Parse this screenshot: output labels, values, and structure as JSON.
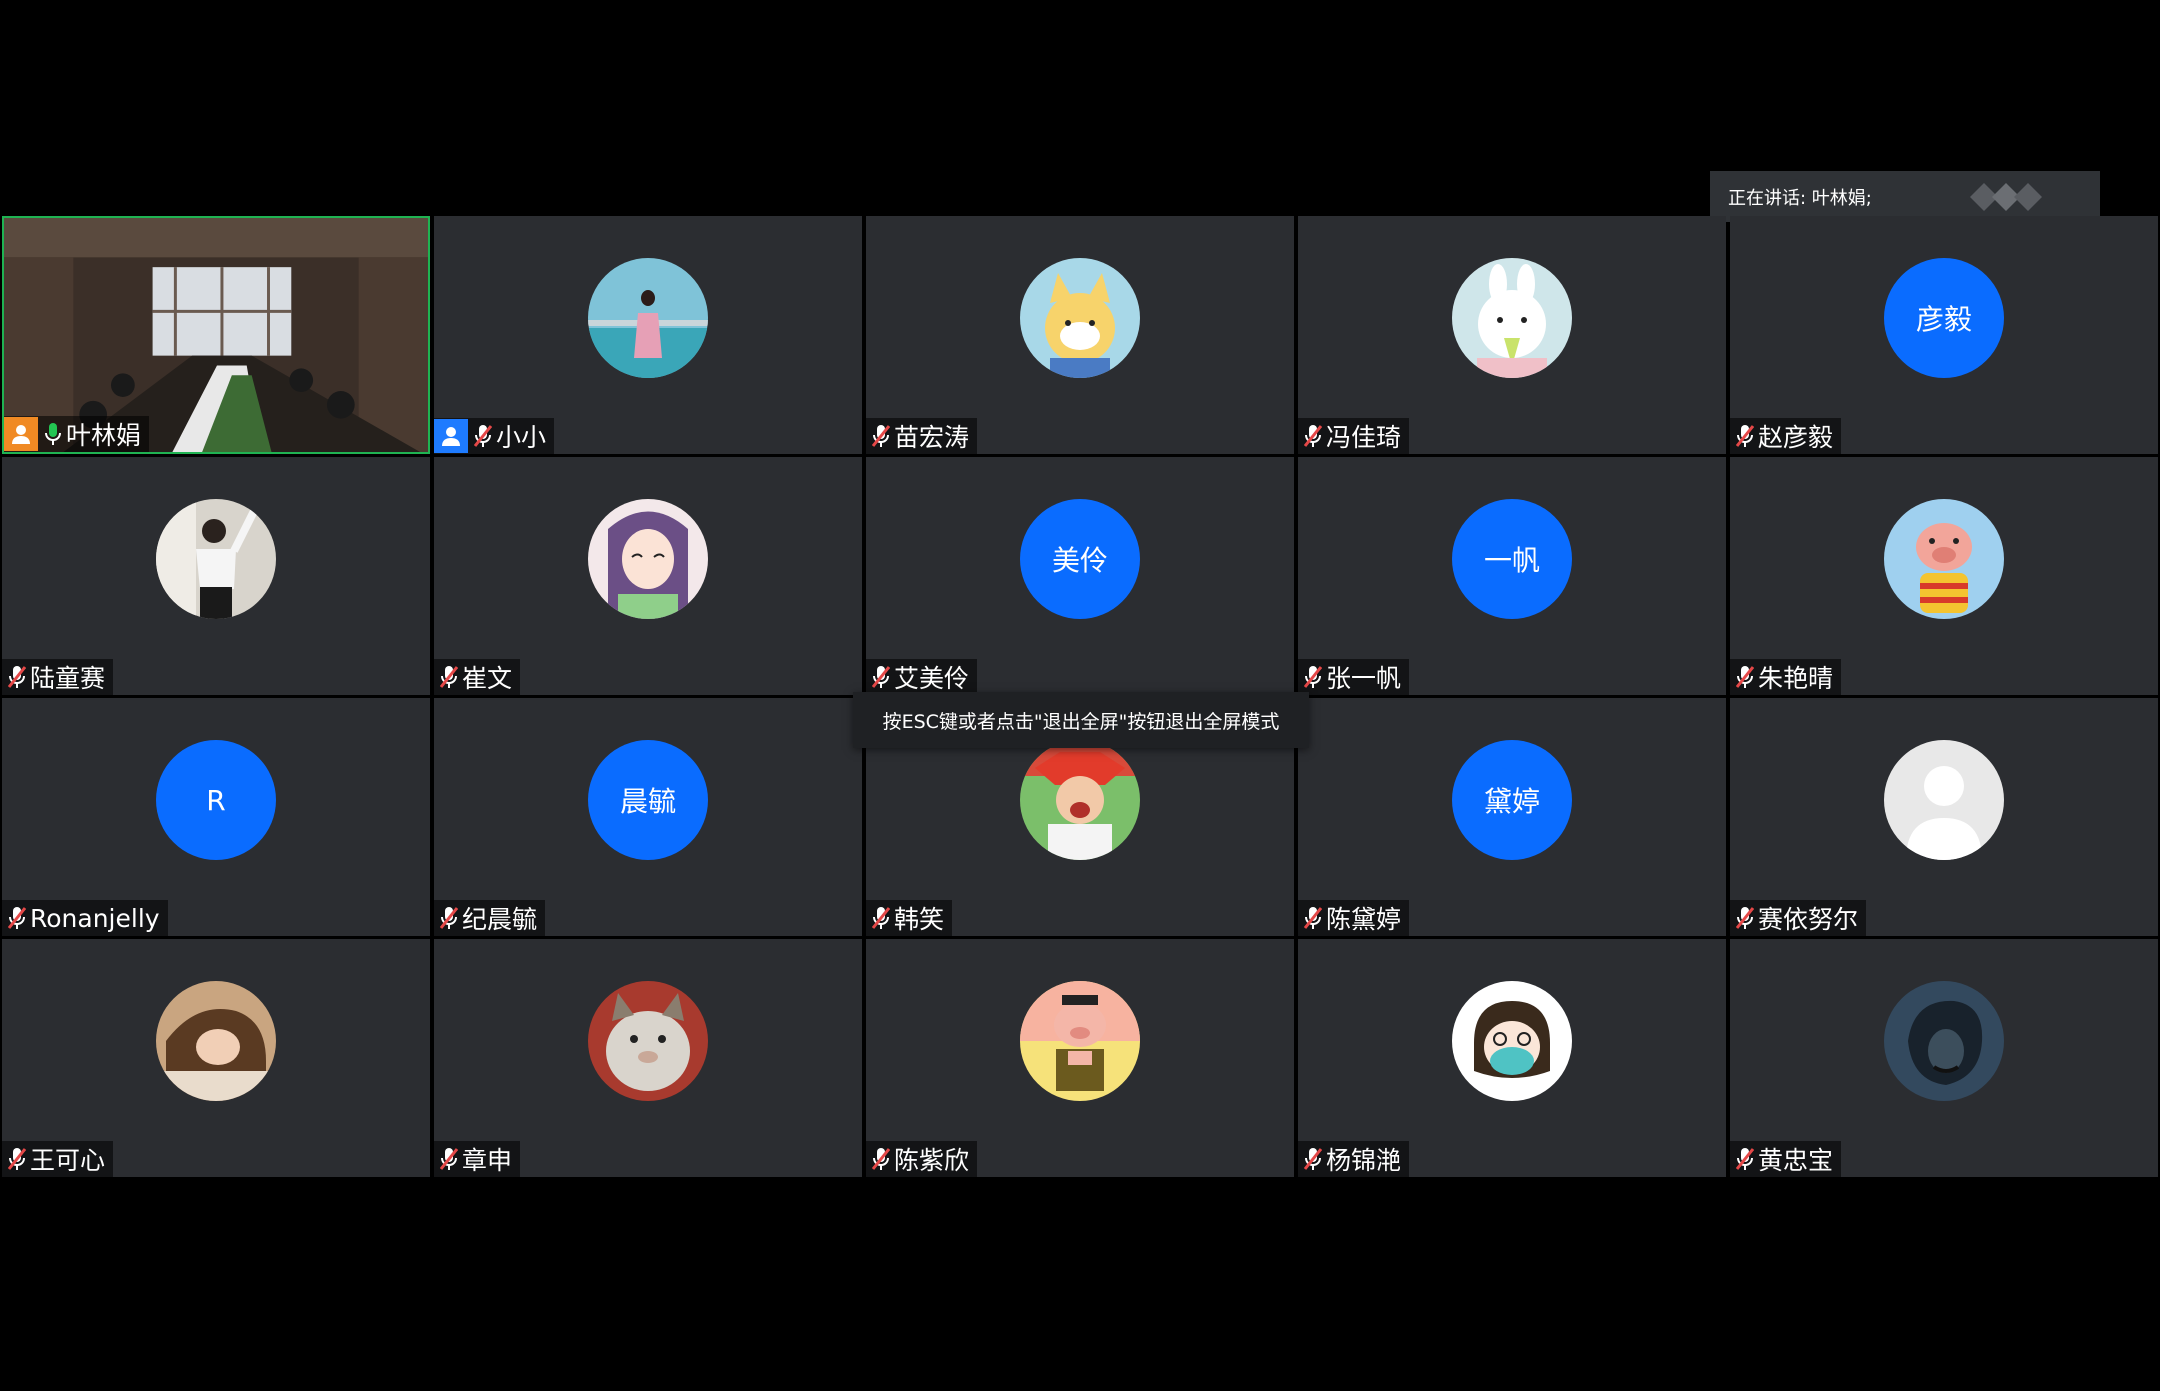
{
  "speaking": {
    "label": "正在讲话: 叶林娟;"
  },
  "tooltip": {
    "text": "按ESC键或者点击\"退出全屏\"按钮退出全屏模式"
  },
  "colors": {
    "accent_blue": "#0a6cff",
    "active_border": "#1fb352",
    "tile_bg": "#2b2d31",
    "host_orange": "#f08a24",
    "cohost_blue": "#1e7bff",
    "mic_on": "#23c552"
  },
  "participants": [
    {
      "name": "叶林娟",
      "avatar": "video-feed",
      "mic": "on",
      "role": "host"
    },
    {
      "name": "小小",
      "avatar": "photo",
      "mic": "muted",
      "role": "cohost"
    },
    {
      "name": "苗宏涛",
      "avatar": "photo",
      "mic": "muted"
    },
    {
      "name": "冯佳琦",
      "avatar": "photo",
      "mic": "muted"
    },
    {
      "name": "赵彦毅",
      "avatar_text": "彦毅",
      "mic": "muted"
    },
    {
      "name": "陆童赛",
      "avatar": "photo",
      "mic": "muted"
    },
    {
      "name": "崔文",
      "avatar": "photo",
      "mic": "muted"
    },
    {
      "name": "艾美伶",
      "avatar_text": "美伶",
      "mic": "muted"
    },
    {
      "name": "张一帆",
      "avatar_text": "一帆",
      "mic": "muted"
    },
    {
      "name": "朱艳晴",
      "avatar": "photo",
      "mic": "muted"
    },
    {
      "name": "Ronanjelly",
      "avatar_text": "R",
      "mic": "muted"
    },
    {
      "name": "纪晨毓",
      "avatar_text": "晨毓",
      "mic": "muted"
    },
    {
      "name": "韩笑",
      "avatar": "photo",
      "mic": "muted"
    },
    {
      "name": "陈黛婷",
      "avatar_text": "黛婷",
      "mic": "muted"
    },
    {
      "name": "赛依努尔",
      "avatar": "default-silhouette",
      "mic": "muted"
    },
    {
      "name": "王可心",
      "avatar": "photo",
      "mic": "muted"
    },
    {
      "name": "章申",
      "avatar": "photo",
      "mic": "muted"
    },
    {
      "name": "陈紫欣",
      "avatar": "photo",
      "mic": "muted"
    },
    {
      "name": "杨锦滟",
      "avatar": "photo",
      "mic": "muted"
    },
    {
      "name": "黄忠宝",
      "avatar": "photo",
      "mic": "muted"
    }
  ]
}
